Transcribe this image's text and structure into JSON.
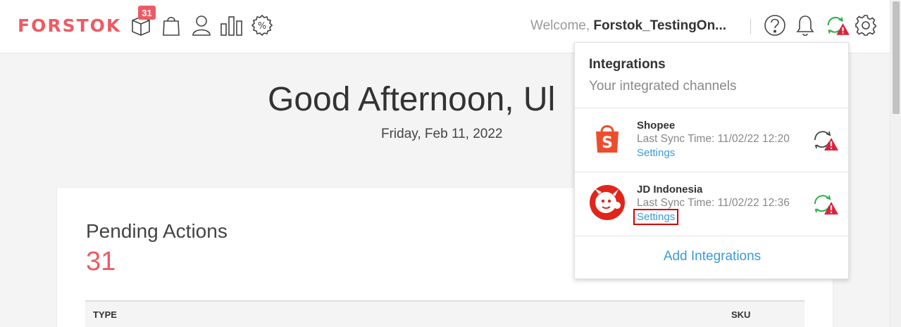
{
  "header": {
    "logo": "FORSTOK",
    "badge_count": "31",
    "welcome_prefix": "Welcome,",
    "username": "Forstok_TestingOn...",
    "nav_icons": [
      "box-icon",
      "shopping-bag-icon",
      "user-icon",
      "bar-chart-icon",
      "promo-percent-icon"
    ],
    "right_icons": [
      "help-icon",
      "bell-icon",
      "sync-warning-icon",
      "gear-icon"
    ]
  },
  "main": {
    "greeting": "Good Afternoon, Ul",
    "date": "Friday, Feb 11, 2022",
    "pending_title": "Pending Actions",
    "pending_count": "31",
    "table_headers": [
      "TYPE",
      "SKU"
    ]
  },
  "dropdown": {
    "title": "Integrations",
    "subtitle": "Your integrated channels",
    "channels": [
      {
        "name": "Shopee",
        "sync": "Last Sync Time: 11/02/22 12:20",
        "settings": "Settings",
        "logo_icon": "shopee-logo-icon",
        "status_icon": "sync-error-icon"
      },
      {
        "name": "JD Indonesia",
        "sync": "Last Sync Time: 11/02/22 12:36",
        "settings": "Settings",
        "logo_icon": "jd-indonesia-logo-icon",
        "status_icon": "sync-warning-icon"
      }
    ],
    "add_label": "Add Integrations"
  },
  "colors": {
    "brand": "#ee5a64",
    "link": "#3a9ad9",
    "highlight_box": "#d40000",
    "shopee": "#ee4d2d",
    "jd": "#e1251b",
    "sync_green": "#2db14a"
  }
}
